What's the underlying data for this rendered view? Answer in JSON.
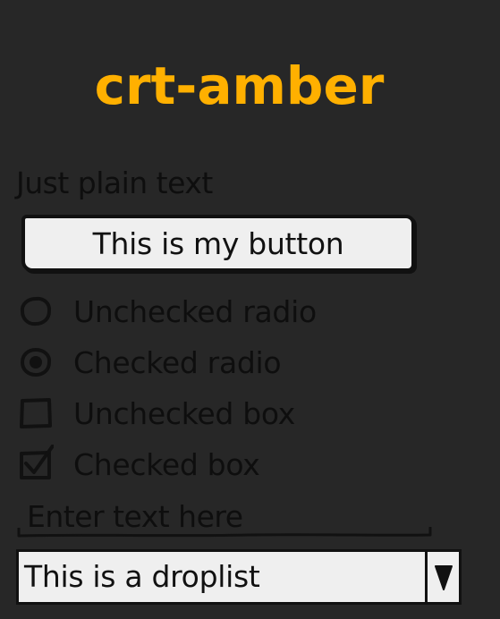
{
  "title": "crt-amber",
  "plain_text": "Just plain text",
  "button": {
    "label": "This is my button"
  },
  "radios": [
    {
      "label": "Unchecked radio",
      "checked": false
    },
    {
      "label": "Checked radio",
      "checked": true
    }
  ],
  "checkboxes": [
    {
      "label": "Unchecked box",
      "checked": false
    },
    {
      "label": "Checked box",
      "checked": true
    }
  ],
  "text_input": {
    "placeholder": "Enter text here",
    "value": ""
  },
  "droplist": {
    "selected": "This is a droplist"
  },
  "icons": {
    "radio_unchecked": "radio-unchecked-icon",
    "radio_checked": "radio-checked-icon",
    "checkbox_unchecked": "checkbox-unchecked-icon",
    "checkbox_checked": "checkbox-checked-icon",
    "dropdown_arrow": "dropdown-arrow-icon"
  },
  "colors": {
    "background": "#272727",
    "accent": "#ffb000",
    "text": "#0e0e0e",
    "control_fill": "#efefef",
    "stroke": "#111111"
  }
}
